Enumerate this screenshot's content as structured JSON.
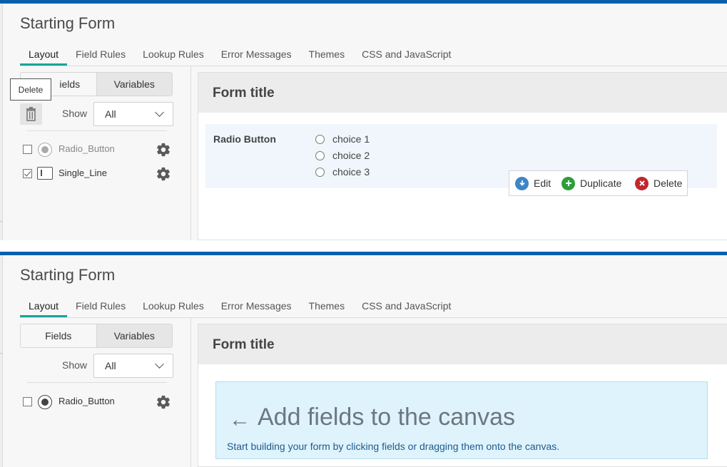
{
  "panel_top": {
    "app_title": "Starting Form",
    "tabs": [
      {
        "label": "Layout",
        "active": true
      },
      {
        "label": "Field Rules"
      },
      {
        "label": "Lookup Rules"
      },
      {
        "label": "Error Messages"
      },
      {
        "label": "Themes"
      },
      {
        "label": "CSS and JavaScript"
      }
    ],
    "sidebar": {
      "seg_fields": "Fields",
      "seg_fields_visible": "ields",
      "seg_variables": "Variables",
      "show_label": "Show",
      "show_value": "All",
      "tooltip": "Delete",
      "fields": [
        {
          "name": "Radio_Button",
          "type": "radio",
          "checked": false
        },
        {
          "name": "Single_Line",
          "type": "single-line",
          "checked": true
        }
      ]
    },
    "canvas": {
      "form_title": "Form title",
      "field": {
        "label": "Radio Button",
        "choices": [
          "choice 1",
          "choice 2",
          "choice 3"
        ]
      },
      "actions": {
        "edit": "Edit",
        "duplicate": "Duplicate",
        "delete": "Delete"
      }
    }
  },
  "panel_bottom": {
    "app_title": "Starting Form",
    "tabs": [
      {
        "label": "Layout",
        "active": true
      },
      {
        "label": "Field Rules"
      },
      {
        "label": "Lookup Rules"
      },
      {
        "label": "Error Messages"
      },
      {
        "label": "Themes"
      },
      {
        "label": "CSS and JavaScript"
      }
    ],
    "sidebar": {
      "seg_fields": "Fields",
      "seg_variables": "Variables",
      "show_label": "Show",
      "show_value": "All",
      "fields": [
        {
          "name": "Radio_Button",
          "type": "radio",
          "checked": false
        }
      ]
    },
    "canvas": {
      "form_title": "Form title",
      "empty_arrow": "←",
      "empty_title": "Add fields to the canvas",
      "empty_subtitle": "Start building your form by clicking fields or dragging them onto the canvas."
    }
  },
  "colors": {
    "top_bar": "#0a5fad",
    "tab_underline": "#1aa39a",
    "edit": "#3d85c6",
    "duplicate": "#2e9e3a",
    "delete": "#c0272d"
  }
}
